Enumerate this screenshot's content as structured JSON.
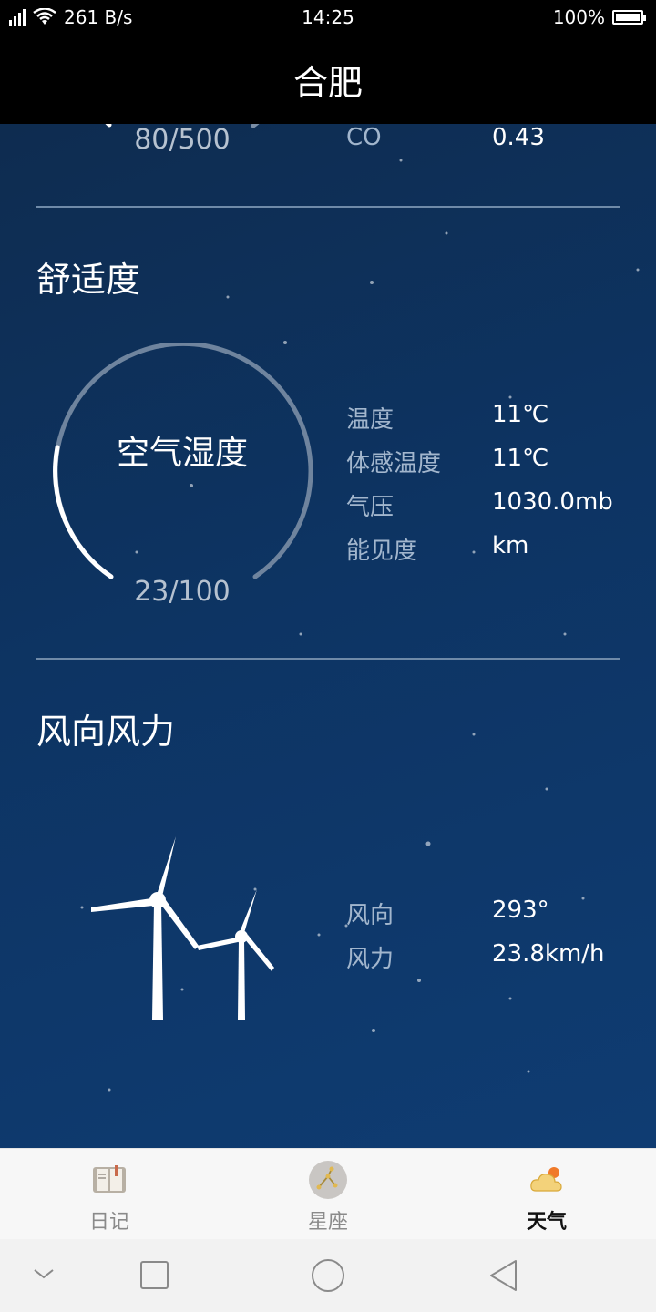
{
  "status_bar": {
    "net_speed": "261 B/s",
    "time": "14:25",
    "battery": "100%"
  },
  "header": {
    "title": "合肥"
  },
  "air_quality": {
    "gauge_value": "80/500",
    "gauge_fraction": 0.16,
    "pollutant_label": "CO",
    "pollutant_value": "0.43"
  },
  "comfort": {
    "title": "舒适度",
    "gauge_label": "空气湿度",
    "gauge_value": "23/100",
    "gauge_fraction": 0.23,
    "rows": [
      {
        "label": "温度",
        "value": "11℃"
      },
      {
        "label": "体感温度",
        "value": "11℃"
      },
      {
        "label": "气压",
        "value": "1030.0mb"
      },
      {
        "label": "能见度",
        "value": "km"
      }
    ]
  },
  "wind": {
    "title": "风向风力",
    "rows": [
      {
        "label": "风向",
        "value": "293°"
      },
      {
        "label": "风力",
        "value": "23.8km/h"
      }
    ]
  },
  "bottom_nav": {
    "items": [
      {
        "label": "日记",
        "icon": "diary-book-icon",
        "active": false
      },
      {
        "label": "星座",
        "icon": "constellation-icon",
        "active": false
      },
      {
        "label": "天气",
        "icon": "weather-cloud-sun-icon",
        "active": true
      }
    ]
  },
  "colors": {
    "background": "#0d3463",
    "accent_white": "#ffffff",
    "label": "#a2b6cd"
  }
}
